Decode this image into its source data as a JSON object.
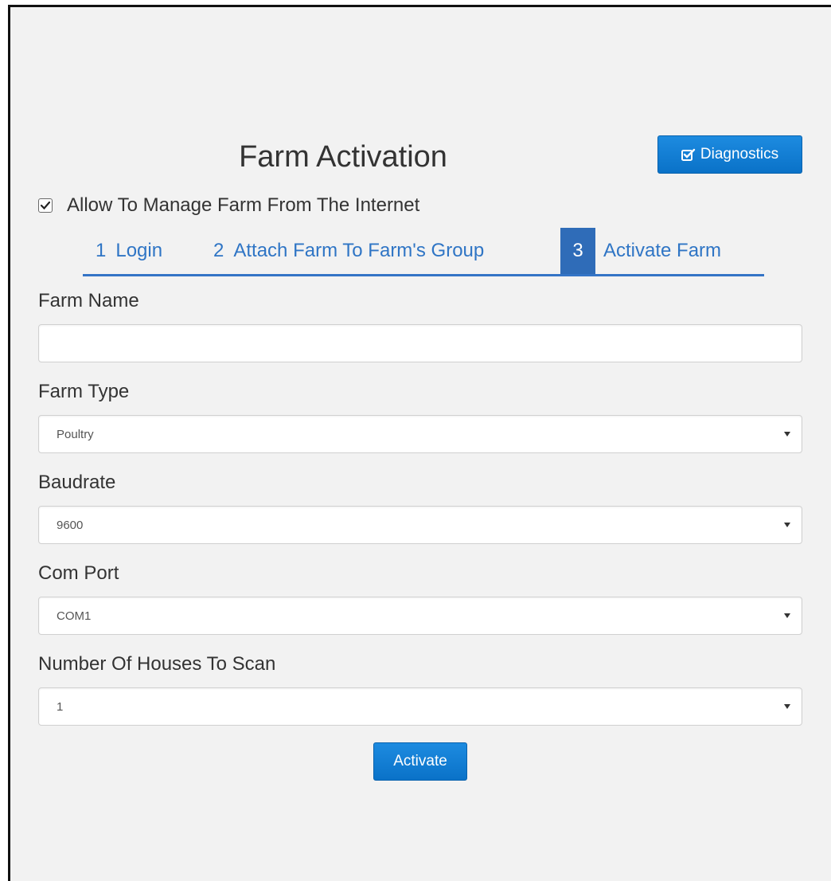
{
  "header": {
    "title": "Farm Activation",
    "diagnostics_label": "Diagnostics",
    "diagnostics_icon": "checkbox-edit-icon"
  },
  "allow_internet": {
    "label": "Allow To Manage Farm From The Internet",
    "checked": true
  },
  "steps": [
    {
      "number": "1",
      "label": "Login",
      "active": false
    },
    {
      "number": "2",
      "label": "Attach Farm To Farm's Group",
      "active": false
    },
    {
      "number": "3",
      "label": "Activate Farm",
      "active": true
    }
  ],
  "form": {
    "farm_name": {
      "label": "Farm Name",
      "value": ""
    },
    "farm_type": {
      "label": "Farm Type",
      "value": "Poultry"
    },
    "baudrate": {
      "label": "Baudrate",
      "value": "9600"
    },
    "com_port": {
      "label": "Com Port",
      "value": "COM1"
    },
    "houses": {
      "label": "Number Of Houses To Scan",
      "value": "1"
    }
  },
  "activate_label": "Activate",
  "colors": {
    "accent": "#0a72c8",
    "step_link": "#2f75c5",
    "step_active_bg": "#2f6cb8",
    "panel_bg": "#f2f2f2"
  }
}
